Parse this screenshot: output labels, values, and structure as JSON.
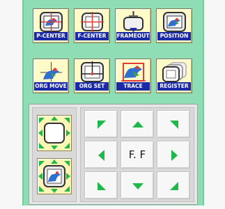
{
  "toolbar": {
    "row1": [
      {
        "label": "P-CENTER",
        "icon": "hoop-bird-center-icon"
      },
      {
        "label": "F-CENTER",
        "icon": "frame-crosshair-icon"
      },
      {
        "label": "FRAMEOUT",
        "icon": "frame-out-icon"
      },
      {
        "label": "POSITION",
        "icon": "bird-position-icon"
      }
    ],
    "row2": [
      {
        "label": "ORG MOVE",
        "icon": "origin-move-icon"
      },
      {
        "label": "ORG SET",
        "icon": "origin-set-icon"
      },
      {
        "label": "TRACE",
        "icon": "trace-bird-icon"
      },
      {
        "label": "REGISTER",
        "icon": "register-frames-icon"
      }
    ]
  },
  "jog": {
    "center_label": "F. F",
    "directions": [
      "up-left",
      "up",
      "up-right",
      "left",
      "right",
      "down-left",
      "down",
      "down-right"
    ]
  },
  "colors": {
    "panel_bg": "#8fddb4",
    "label_bg": "#1b2aa6",
    "arrow_green": "#1fb84a",
    "button_face": "#fffbc9"
  }
}
